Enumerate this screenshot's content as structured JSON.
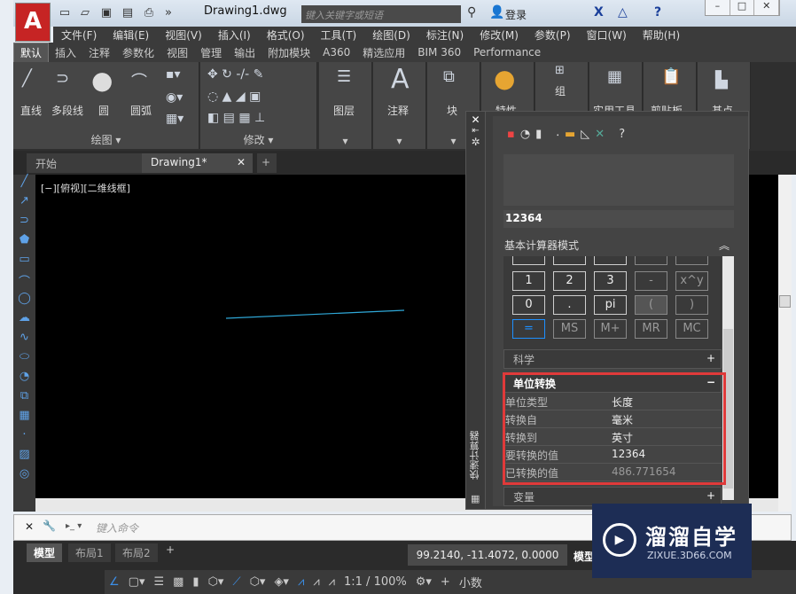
{
  "title_bar": {
    "document": "Drawing1.dwg",
    "search_placeholder": "键入关键字或短语",
    "login": "登录"
  },
  "menu": [
    "文件(F)",
    "编辑(E)",
    "视图(V)",
    "插入(I)",
    "格式(O)",
    "工具(T)",
    "绘图(D)",
    "标注(N)",
    "修改(M)",
    "参数(P)",
    "窗口(W)",
    "帮助(H)"
  ],
  "ribbon_tabs": [
    "默认",
    "插入",
    "注释",
    "参数化",
    "视图",
    "管理",
    "输出",
    "附加模块",
    "A360",
    "精选应用",
    "BIM 360",
    "Performance"
  ],
  "ribbon": {
    "draw_tools": [
      "直线",
      "多段线",
      "圆",
      "圆弧"
    ],
    "draw_panel": "绘图 ▾",
    "modify_panel": "修改 ▾",
    "big": [
      "图层",
      "注释",
      "块",
      "特性",
      "组",
      "实用工具",
      "剪贴板",
      "基点"
    ]
  },
  "doc_tabs": [
    "开始",
    "Drawing1*"
  ],
  "viewport_label": "[−][俯视][二维线框]",
  "calculator": {
    "title": "快速计算器",
    "input": "12364",
    "mode": "基本计算器模式",
    "keys": [
      [
        "1",
        "2",
        "3",
        "-",
        "x^y"
      ],
      [
        "0",
        ".",
        "pi",
        "(",
        ")"
      ],
      [
        "=",
        "MS",
        "M+",
        "MR",
        "MC"
      ]
    ],
    "science": "科学",
    "unit_conversion": "单位转换",
    "rows": [
      {
        "label": "单位类型",
        "value": "长度"
      },
      {
        "label": "转换自",
        "value": "毫米"
      },
      {
        "label": "转换到",
        "value": "英寸"
      },
      {
        "label": "要转换的值",
        "value": "12364"
      },
      {
        "label": "已转换的值",
        "value": "486.771654"
      }
    ],
    "variables": "变量"
  },
  "command": {
    "placeholder": "键入命令"
  },
  "layout_tabs": [
    "模型",
    "布局1",
    "布局2"
  ],
  "status": {
    "coords": "99.2140, -11.4072, 0.0000",
    "model": "模型",
    "scale": "1:1 / 100%",
    "units": "小数"
  },
  "watermark": {
    "name": "溜溜自学",
    "url": "ZIXUE.3D66.COM"
  },
  "colors": {
    "accent": "#1e90ff",
    "highlight_box": "#e03a3a",
    "logo": "#c62424"
  }
}
